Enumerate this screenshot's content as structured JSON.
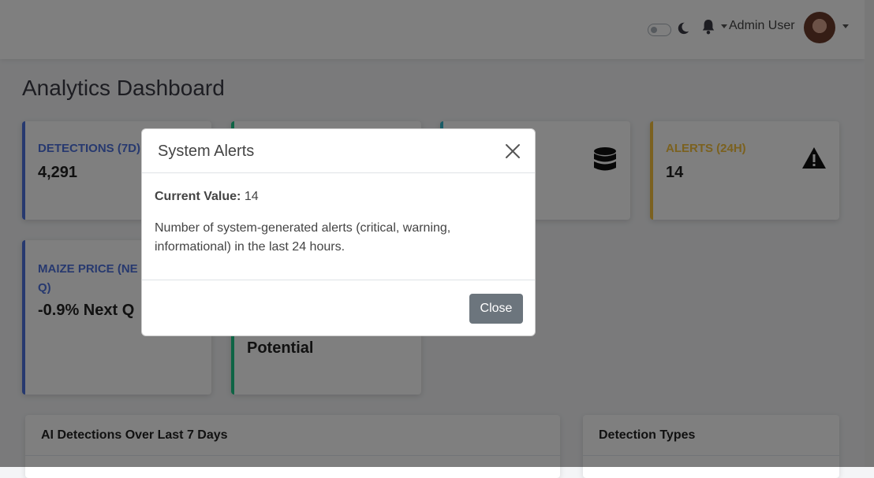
{
  "header": {
    "user_name": "Admin User",
    "icons": [
      "theme-toggle",
      "moon-icon",
      "bell-icon",
      "avatar"
    ]
  },
  "page": {
    "title": "Analytics Dashboard"
  },
  "cards": [
    {
      "label": "DETECTIONS (7D)",
      "value": "4,291",
      "color": "#4e73df"
    },
    {
      "label": "",
      "value": "",
      "color": "#1cc88a"
    },
    {
      "label": "",
      "value": "",
      "color": "#36b9cc",
      "icon": "database-icon"
    },
    {
      "label": "ALERTS (24H)",
      "value": "14",
      "color": "#f6c23e",
      "icon": "warning-icon"
    },
    {
      "label_line1": "MAIZE PRICE (NE",
      "label_line2": "Q)",
      "value": "-0.9% Next Q",
      "color": "#4e73df"
    },
    {
      "value_line2": "Potential",
      "color": "#1cc88a"
    }
  ],
  "panels": [
    {
      "title": "AI Detections Over Last 7 Days"
    },
    {
      "title": "Detection Types"
    }
  ],
  "modal": {
    "title": "System Alerts",
    "current_value_label": "Current Value:",
    "current_value": "14",
    "description": "Number of system-generated alerts (critical, warning, informational) in the last 24 hours.",
    "close_label": "Close"
  }
}
